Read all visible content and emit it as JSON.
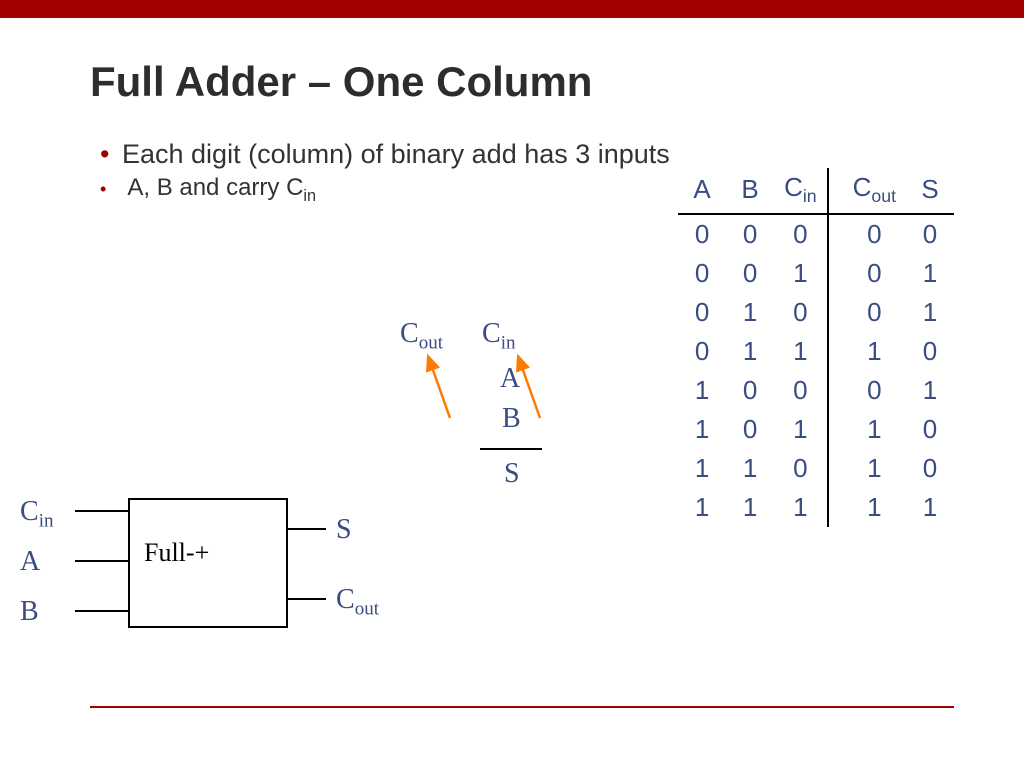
{
  "title": "Full Adder – One Column",
  "bullet_main": "Each digit (column) of binary add has 3 inputs",
  "bullet_sub_prefix": "A, B and carry C",
  "bullet_sub_sub": "in",
  "block": {
    "label": "Full-+",
    "in": {
      "cin": "C",
      "cin_sub": "in",
      "a": "A",
      "b": "B"
    },
    "out": {
      "s": "S",
      "cout": "C",
      "cout_sub": "out"
    }
  },
  "coladd": {
    "cout": "C",
    "cout_sub": "out",
    "cin": "C",
    "cin_sub": "in",
    "a": "A",
    "b": "B",
    "s": "S"
  },
  "table": {
    "headers": {
      "a": "A",
      "b": "B",
      "cin": "C",
      "cin_sub": "in",
      "cout": "C",
      "cout_sub": "out",
      "s": "S"
    },
    "rows": [
      {
        "a": 0,
        "b": 0,
        "cin": 0,
        "cout": 0,
        "s": 0
      },
      {
        "a": 0,
        "b": 0,
        "cin": 1,
        "cout": 0,
        "s": 1
      },
      {
        "a": 0,
        "b": 1,
        "cin": 0,
        "cout": 0,
        "s": 1
      },
      {
        "a": 0,
        "b": 1,
        "cin": 1,
        "cout": 1,
        "s": 0
      },
      {
        "a": 1,
        "b": 0,
        "cin": 0,
        "cout": 0,
        "s": 1
      },
      {
        "a": 1,
        "b": 0,
        "cin": 1,
        "cout": 1,
        "s": 0
      },
      {
        "a": 1,
        "b": 1,
        "cin": 0,
        "cout": 1,
        "s": 0
      },
      {
        "a": 1,
        "b": 1,
        "cin": 1,
        "cout": 1,
        "s": 1
      }
    ]
  }
}
